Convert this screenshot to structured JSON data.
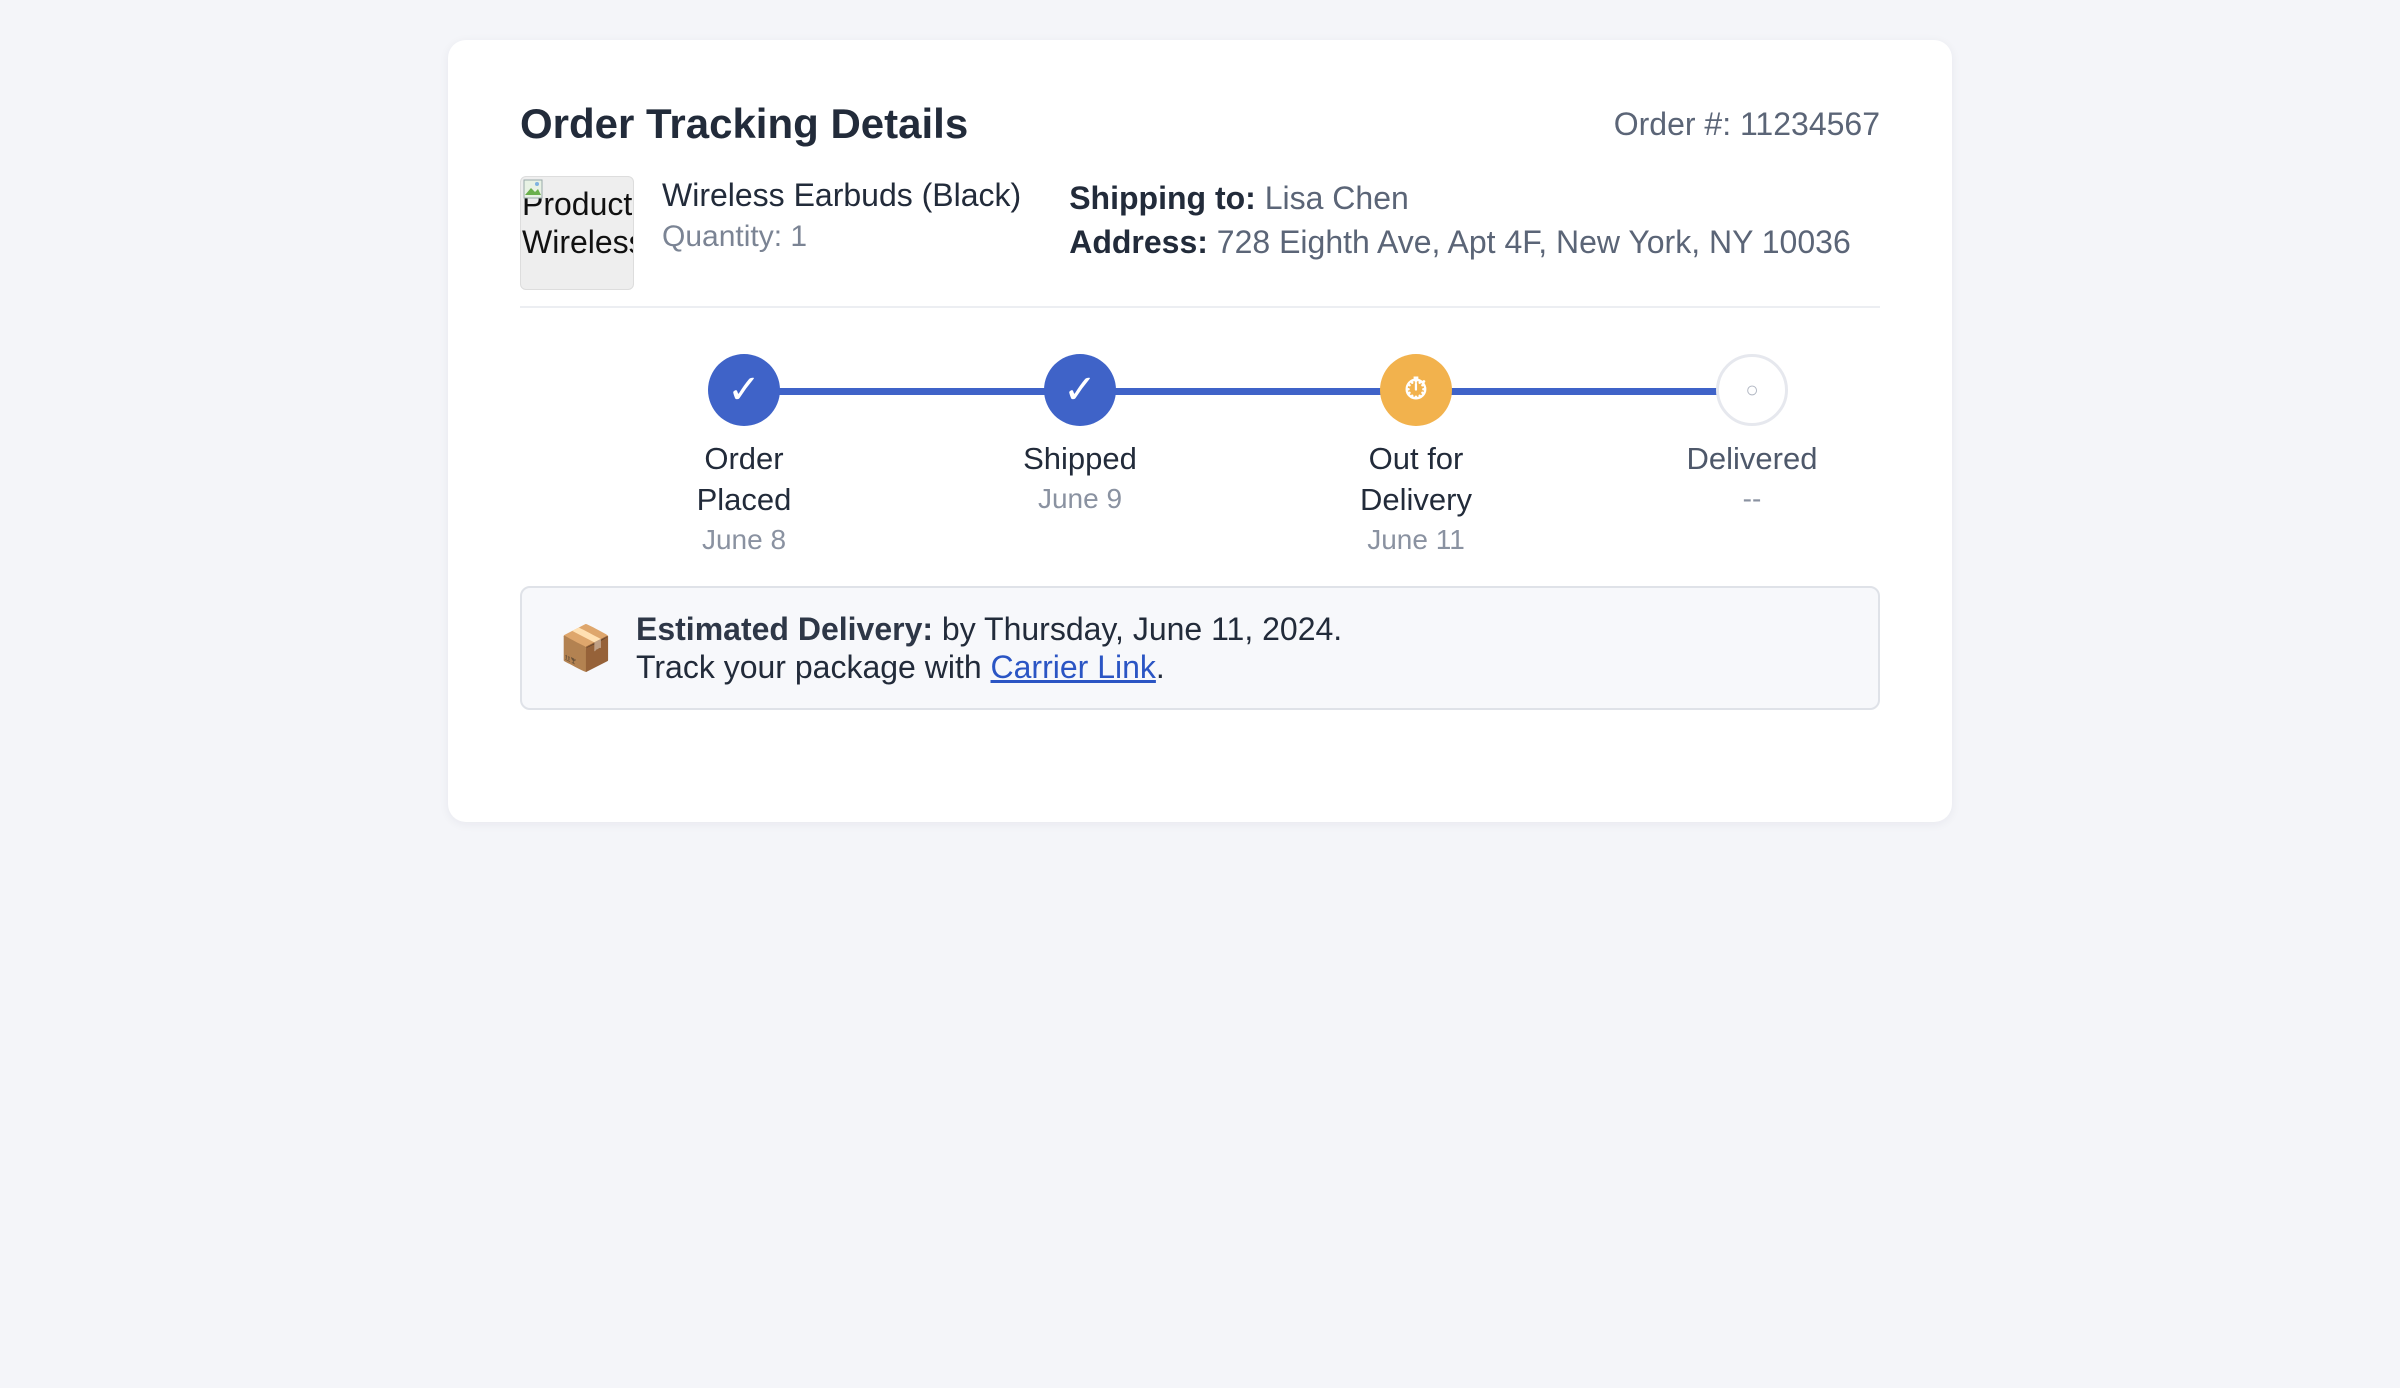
{
  "header": {
    "title": "Order Tracking Details",
    "order_number": "Order #: 11234567"
  },
  "product": {
    "image_alt": "Product Wireless",
    "image_alt_line1": "Product",
    "image_alt_line2": "Wireless",
    "name": "Wireless Earbuds (Black)",
    "quantity": "Quantity: 1"
  },
  "shipping": {
    "to_label": "Shipping to:",
    "to_value": "Lisa Chen",
    "address_label": "Address:",
    "address_value": "728 Eighth Ave, Apt 4F, New York, NY 10036"
  },
  "steps": [
    {
      "label_line1": "Order",
      "label_line2": "Placed",
      "date": "June 8",
      "status": "done",
      "icon": "✓",
      "icon_name": "check-icon"
    },
    {
      "label_line1": "Shipped",
      "label_line2": "",
      "date": "June 9",
      "status": "done",
      "icon": "✓",
      "icon_name": "check-icon"
    },
    {
      "label_line1": "Out for",
      "label_line2": "Delivery",
      "date": "June 11",
      "status": "active",
      "icon": "⏱",
      "icon_name": "stopwatch-icon"
    },
    {
      "label_line1": "Delivered",
      "label_line2": "",
      "date": "--",
      "status": "pending",
      "icon": "○",
      "icon_name": "empty-circle-icon"
    }
  ],
  "estimate": {
    "icon": "📦",
    "label": "Estimated Delivery:",
    "value": "by Thursday, June 11, 2024.",
    "track_prefix": "Track your package with",
    "link_text": "Carrier Link",
    "track_suffix": "."
  },
  "colors": {
    "accent": "#3f63c8",
    "active": "#f2b24d",
    "background": "#f4f5f9"
  }
}
